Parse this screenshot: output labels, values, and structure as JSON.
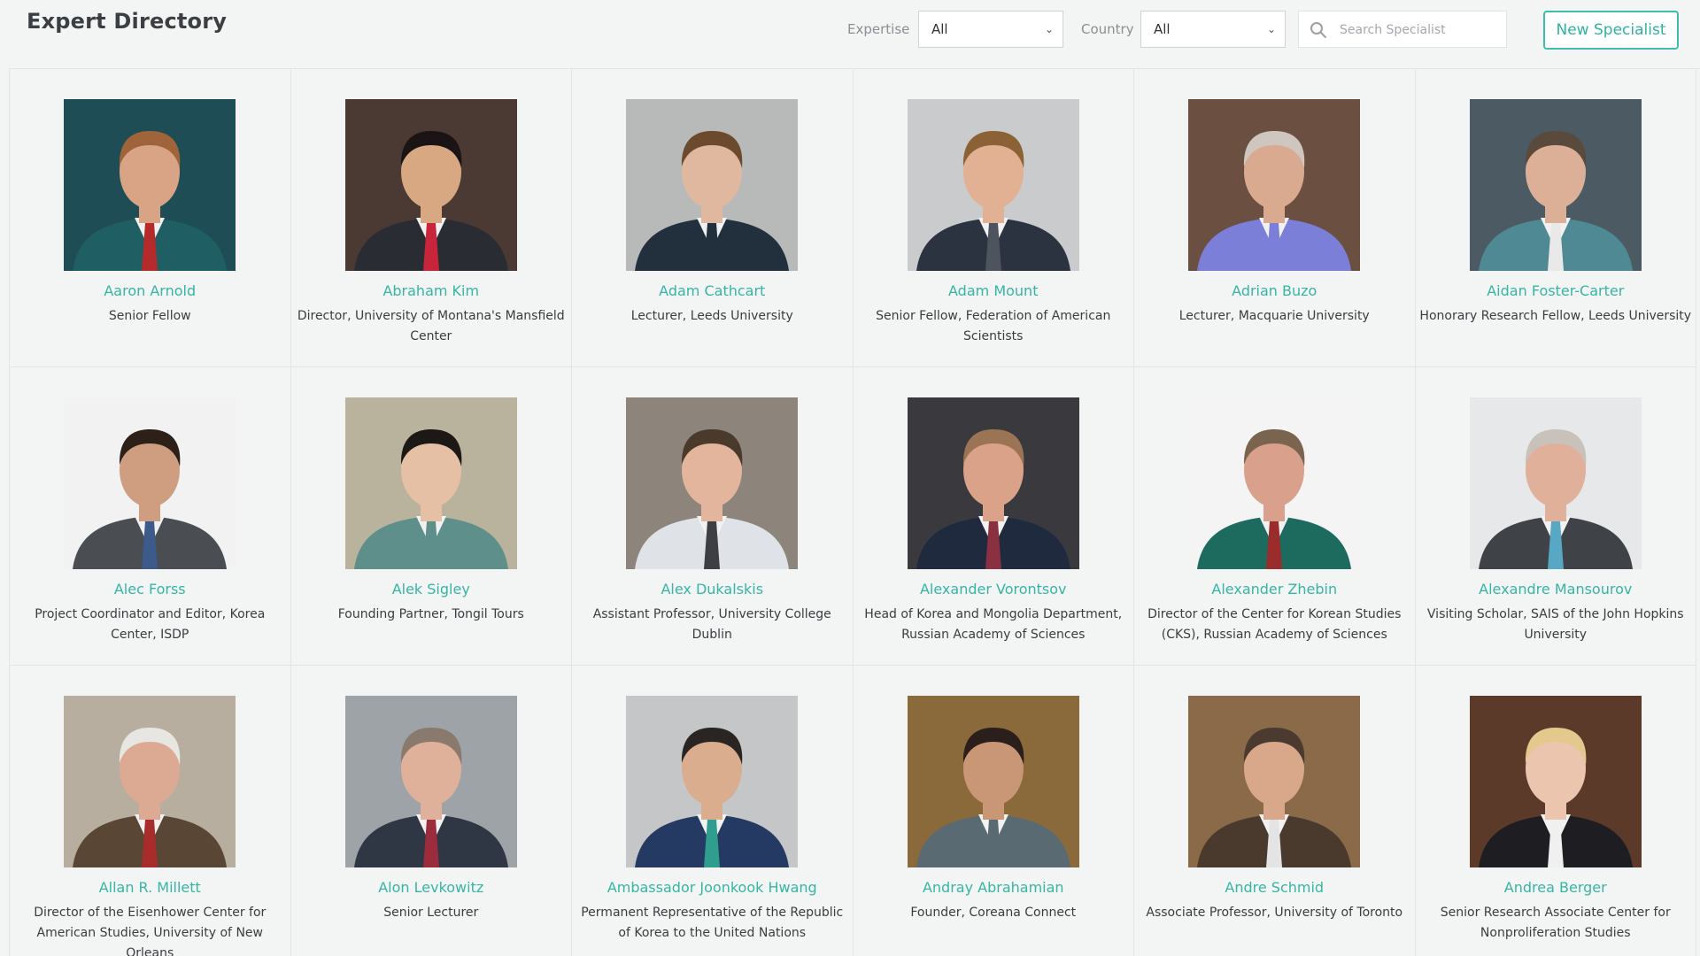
{
  "header": {
    "title": "Expert Directory",
    "expertise_label": "Expertise",
    "expertise_value": "All",
    "country_label": "Country",
    "country_value": "All",
    "search_placeholder": "Search Specialist",
    "new_button": "New Specialist"
  },
  "colors": {
    "accent": "#37b5a3",
    "background": "#f3f4f4"
  },
  "experts": [
    {
      "name": "Aaron Arnold",
      "role": "Senior Fellow",
      "bg": "#1e4d55",
      "suit": "#1f5e63",
      "skin": "#d9a385",
      "hair": "#a0643a",
      "tie": "#b52a2a"
    },
    {
      "name": "Abraham Kim",
      "role": "Director, University of Montana's Mansfield Center",
      "bg": "#4a3a33",
      "suit": "#2a2c33",
      "skin": "#d8a883",
      "hair": "#1a1514",
      "tie": "#c8253a"
    },
    {
      "name": "Adam Cathcart",
      "role": "Lecturer, Leeds University",
      "bg": "#b7bab8",
      "suit": "#22303d",
      "skin": "#e0b8a0",
      "hair": "#6b4a2e",
      "tie": "#22303d"
    },
    {
      "name": "Adam Mount",
      "role": "Senior Fellow, Federation of American Scientists",
      "bg": "#c9cbcc",
      "suit": "#2b3340",
      "skin": "#e2b093",
      "hair": "#8a6236",
      "tie": "#4e545e"
    },
    {
      "name": "Adrian Buzo",
      "role": "Lecturer, Macquarie University",
      "bg": "#6b5042",
      "suit": "#7c7fd8",
      "skin": "#d9aa8f",
      "hair": "#cfc7bf",
      "tie": "#7c7fd8"
    },
    {
      "name": "Aidan Foster-Carter",
      "role": "Honorary Research Fellow, Leeds University",
      "bg": "#4b5a63",
      "suit": "#4f8a94",
      "skin": "#dcb096",
      "hair": "#5a4a3e",
      "tie": "#e9e9e9"
    },
    {
      "name": "Alec Forss",
      "role": "Project Coordinator and Editor, Korea Center, ISDP",
      "bg": "#f2f2f2",
      "suit": "#4a4d52",
      "skin": "#cf9e80",
      "hair": "#2c2019",
      "tie": "#3c5a8a"
    },
    {
      "name": "Alek Sigley",
      "role": "Founding Partner, Tongil Tours",
      "bg": "#b9b39e",
      "suit": "#5e8f8a",
      "skin": "#e6c0a4",
      "hair": "#1c1816",
      "tie": "#5e8f8a"
    },
    {
      "name": "Alex Dukalskis",
      "role": "Assistant Professor, University College Dublin",
      "bg": "#8d857c",
      "suit": "#dfe2e6",
      "skin": "#e2b59c",
      "hair": "#4a3a2c",
      "tie": "#3d3f44"
    },
    {
      "name": "Alexander Vorontsov",
      "role": "Head of Korea and Mongolia Department, Russian Academy of Sciences",
      "bg": "#3a3a3e",
      "suit": "#1f2a3e",
      "skin": "#dba28a",
      "hair": "#9a7454",
      "tie": "#8a3040"
    },
    {
      "name": "Alexander Zhebin",
      "role": "Director of the Center for Korean Studies (CKS), Russian Academy of Sciences",
      "bg": "#f4f4f4",
      "suit": "#1d6a5e",
      "skin": "#d9a18b",
      "hair": "#7a6450",
      "tie": "#9b2c2c"
    },
    {
      "name": "Alexandre Mansourov",
      "role": "Visiting Scholar, SAIS of the John Hopkins University",
      "bg": "#e6e8ea",
      "suit": "#3f4247",
      "skin": "#e0b09b",
      "hair": "#c9c2bb",
      "tie": "#58a7c4"
    },
    {
      "name": "Allan R. Millett",
      "role": "Director of the Eisenhower Center for American Studies, University of New Orleans",
      "bg": "#b8aea0",
      "suit": "#5a4634",
      "skin": "#dcaa92",
      "hair": "#e8e6e2",
      "tie": "#a82c2c"
    },
    {
      "name": "Alon Levkowitz",
      "role": "Senior Lecturer",
      "bg": "#9da3a6",
      "suit": "#2f3744",
      "skin": "#dfb19a",
      "hair": "#8a7a6e",
      "tie": "#9a2c3c"
    },
    {
      "name": "Ambassador Joonkook Hwang",
      "role": "Permanent Representative of the Republic of Korea to the United Nations",
      "bg": "#c4c6c7",
      "suit": "#253a63",
      "skin": "#d9ad8e",
      "hair": "#2a2522",
      "tie": "#2f9e8e"
    },
    {
      "name": "Andray Abrahamian",
      "role": "Founder, Coreana Connect",
      "bg": "#8a6a3a",
      "suit": "#5a6a72",
      "skin": "#c99676",
      "hair": "#2a1f1a",
      "tie": "#5a6a72"
    },
    {
      "name": "Andre Schmid",
      "role": "Associate Professor, University of Toronto",
      "bg": "#8a6a48",
      "suit": "#4a3a2e",
      "skin": "#d9a78a",
      "hair": "#4a3a30",
      "tie": "#e4e4e4"
    },
    {
      "name": "Andrea Berger",
      "role": "Senior Research Associate Center for Nonproliferation Studies",
      "bg": "#5c3a2a",
      "suit": "#1e1e22",
      "skin": "#ebc5ad",
      "hair": "#e3c98d",
      "tie": "#f0f0f0"
    }
  ]
}
